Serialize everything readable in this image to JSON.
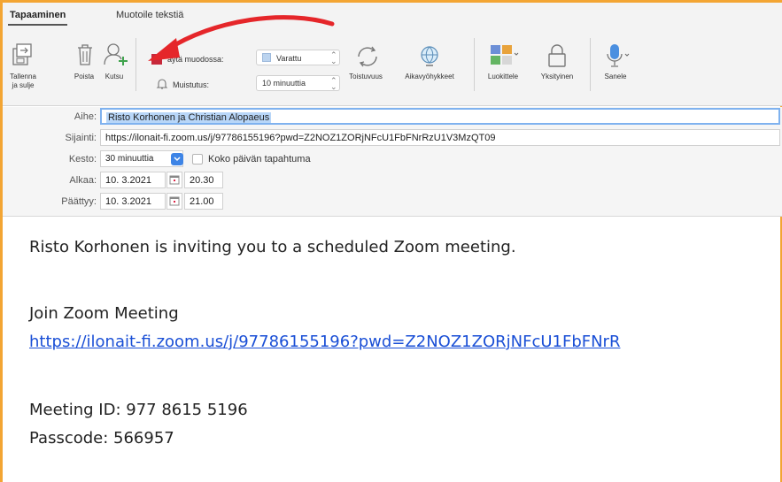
{
  "tabs": [
    {
      "label": "Tapaaminen",
      "active": true
    },
    {
      "label": "Muotoile tekstiä",
      "active": false
    }
  ],
  "ribbon": {
    "save_close_label_1": "Tallenna",
    "save_close_label_2": "ja sulje",
    "delete_label": "Poista",
    "invite_label": "Kutsu",
    "show_as_label": "äytä muodossa:",
    "show_as_value": "Varattu",
    "reminder_label": "Muistutus:",
    "reminder_value": "10 minuuttia",
    "recurrence_label": "Toistuvuus",
    "timezones_label": "Aikavyöhykkeet",
    "categorize_label": "Luokittele",
    "private_label": "Yksityinen",
    "dictate_label": "Sanele"
  },
  "form": {
    "subject_label": "Aihe:",
    "subject_value": "Risto Korhonen ja Christian Alopaeus",
    "location_label": "Sijainti:",
    "location_value": "https://ilonait-fi.zoom.us/j/97786155196?pwd=Z2NOZ1ZORjNFcU1FbFNrRzU1V3MzQT09",
    "duration_label": "Kesto:",
    "duration_value": "30 minuuttia",
    "allday_label": "Koko päivän tapahtuma",
    "start_label": "Alkaa:",
    "start_date": "10. 3.2021",
    "start_time": "20.30",
    "end_label": "Päättyy:",
    "end_date": "10. 3.2021",
    "end_time": "21.00"
  },
  "body": {
    "line1": "Risto Korhonen is inviting you to a scheduled Zoom meeting.",
    "line2": "Join Zoom Meeting",
    "link": "https://ilonait-fi.zoom.us/j/97786155196?pwd=Z2NOZ1ZORjNFcU1FbFNrR",
    "meeting_id": "Meeting ID: 977 8615 5196",
    "passcode": "Passcode: 566957"
  },
  "colors": {
    "frame": "#f3a533",
    "annotation_arrow": "#e5262a",
    "link": "#1a4fd6",
    "selection": "#b8d6f8",
    "accent_blue": "#3d84e6"
  }
}
